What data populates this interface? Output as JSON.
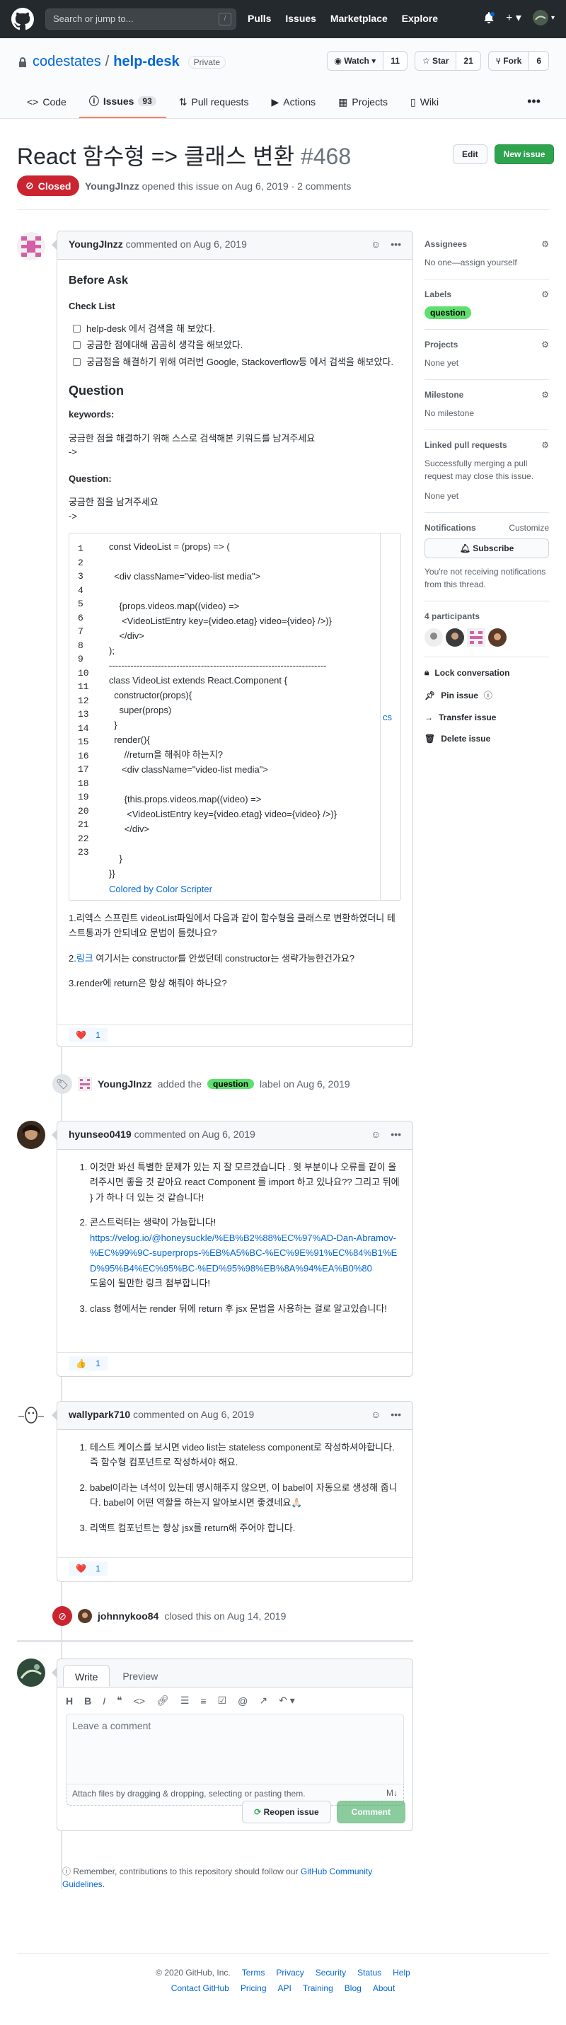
{
  "header": {
    "search_placeholder": "Search or jump to...",
    "search_key": "/",
    "nav": [
      "Pulls",
      "Issues",
      "Marketplace",
      "Explore"
    ]
  },
  "repo": {
    "owner": "codestates",
    "separator": "/",
    "name": "help-desk",
    "visibility": "Private",
    "watch_label": "Watch",
    "watch_count": "11",
    "star_label": "Star",
    "star_count": "21",
    "fork_label": "Fork",
    "fork_count": "6",
    "tabs": [
      {
        "label": "Code"
      },
      {
        "label": "Issues",
        "count": "93"
      },
      {
        "label": "Pull requests"
      },
      {
        "label": "Actions"
      },
      {
        "label": "Projects"
      },
      {
        "label": "Wiki"
      }
    ]
  },
  "issue": {
    "title": "React 함수형 => 클래스 변환",
    "number": "#468",
    "edit_label": "Edit",
    "new_issue_label": "New issue",
    "state": "Closed",
    "author": "YoungJInzz",
    "opened_text": "opened this issue on Aug 6, 2019 · 2 comments"
  },
  "first_comment": {
    "author": "YoungJInzz",
    "action": "commented on Aug 6, 2019",
    "before_ask": "Before Ask",
    "check_list": "Check List",
    "checks": [
      "help-desk 에서 검색을 해 보았다.",
      "궁금한 점에대해 곰곰히 생각을 해보았다.",
      "궁금점을 해결하기 위해 여러번 Google, Stackoverflow등 에서 검색을 해보았다."
    ],
    "question_heading": "Question",
    "keywords_label": "keywords:",
    "keywords_text": "궁금한 점을 해결하기 위해 스스로 검색해본 키워드를 남겨주세요",
    "arrow1": "->",
    "question_label": "Question:",
    "question_text": "궁금한 점을 남겨주세요",
    "arrow2": "->",
    "line_numbers": [
      "1",
      "2",
      "3",
      "4",
      "5",
      "6",
      "7",
      "8",
      "9",
      "10",
      "11",
      "12",
      "13",
      "14",
      "15",
      "16",
      "17",
      "18",
      "19",
      "20",
      "21",
      "22",
      "23"
    ],
    "code": "const VideoList = (props) => (\n\n  <div className=\"video-list media\">\n\n    {props.videos.map((video) =>\n     <VideoListEntry key={video.etag} video={video} />)}\n    </div>\n);\n-----------------------------------------------------------------------\nclass VideoList extends React.Component {\n  constructor(props){\n    super(props)\n  }\n  render(){\n      //return을 해줘야 하는지?\n     <div className=\"video-list media\">\n\n      {this.props.videos.map((video) =>\n       <VideoListEntry key={video.etag} video={video} />)}\n      </div>\n\n    }\n}}",
    "colored_by": "Colored by Color Scripter",
    "cs": "cs",
    "q1": "1.리엑스 스프린트 videoList파일에서 다음과 같이 함수형을 클래스로 변환하였더니 테스트통과가 안되네요 문법이 틀렸나요?",
    "q2_link": "링크",
    "q2_rest": " 여기서는 constructor를 안썼던데 constructor는 생략가능한건가요?",
    "q2_prefix": "2.",
    "q3": "3.render에 return은 항상 해줘야 하나요?",
    "reaction_emoji": "❤️",
    "reaction_count": "1"
  },
  "label_event": {
    "actor": "YoungJInzz",
    "added": "added the",
    "label": "question",
    "suffix": "label on Aug 6, 2019"
  },
  "second_comment": {
    "author": "hyunseo0419",
    "action": "commented on Aug 6, 2019",
    "items": [
      "이것만 봐선 특별한 문제가 있는 지 잘 모르겠습니다 . 윗 부분이나 오류를 같이 올려주시면 좋을 것 같아요 react Component 를 import 하고 있나요?? 그리고 뒤에 } 가 하나 더 있는 것 같습니다!",
      "콘스트럭터는 생략이 가능합니다!",
      "class 형에서는 render 뒤에 return 후 jsx 문법을 사용하는 걸로 알고있습니다!"
    ],
    "link": "https://velog.io/@honeysuckle/%EB%B2%88%EC%97%AD-Dan-Abramov-%EC%99%9C-superprops-%EB%A5%BC-%EC%9E%91%EC%84%B1%ED%95%B4%EC%95%BC-%ED%95%98%EB%8A%94%EA%B0%80",
    "link_note": "도움이 될만한 링크 첨부합니다!",
    "reaction_emoji": "👍",
    "reaction_count": "1"
  },
  "third_comment": {
    "author": "wallypark710",
    "action": "commented on Aug 6, 2019",
    "items": [
      "테스트 케이스를 보시면 video list는 stateless component로 작성하셔야합니다. 즉 함수형 컴포넌트로 작성하셔야 해요.",
      "babel이라는 녀석이 있는데 명시해주지 않으면, 이 babel이 자동으로 생성해 줍니다. babel이 어떤 역할을 하는지 알아보시면 좋겠네요🙏🏻",
      "리액트 컴포넌트는 항상 jsx를 return해 주어야 합니다."
    ],
    "reaction_emoji": "❤️",
    "reaction_count": "1"
  },
  "close_event": {
    "actor": "johnnykoo84",
    "text": "closed this on Aug 14, 2019"
  },
  "new_comment": {
    "write_tab": "Write",
    "preview_tab": "Preview",
    "toolbar": [
      "H",
      "B",
      "I"
    ],
    "placeholder": "Leave a comment",
    "attach_text": "Attach files by dragging & dropping, selecting or pasting them.",
    "reopen_label": "Reopen issue",
    "comment_label": "Comment",
    "tip_prefix": "Remember, contributions to this repository should follow our",
    "tip_link": "GitHub Community Guidelines",
    "tip_suffix": "."
  },
  "sidebar": {
    "assignees_title": "Assignees",
    "assignees_value": "No one—assign yourself",
    "labels_title": "Labels",
    "label_value": "question",
    "projects_title": "Projects",
    "projects_value": "None yet",
    "milestone_title": "Milestone",
    "milestone_value": "No milestone",
    "linked_title": "Linked pull requests",
    "linked_desc": "Successfully merging a pull request may close this issue.",
    "linked_value": "None yet",
    "notifications_title": "Notifications",
    "customize": "Customize",
    "subscribe": "Subscribe",
    "notif_desc": "You're not receiving notifications from this thread.",
    "participants": "4 participants",
    "actions": [
      "Lock conversation",
      "Pin issue",
      "Transfer issue",
      "Delete issue"
    ]
  },
  "footer": {
    "copyright": "© 2020 GitHub, Inc.",
    "row1": [
      "Terms",
      "Privacy",
      "Security",
      "Status",
      "Help"
    ],
    "row2": [
      "Contact GitHub",
      "Pricing",
      "API",
      "Training",
      "Blog",
      "About"
    ]
  },
  "colors": {
    "closed_red": "#cb2431",
    "green": "#2ea44f",
    "label_green": "#5ee06e",
    "link_blue": "#0366d6",
    "header_dark": "#24292e"
  }
}
